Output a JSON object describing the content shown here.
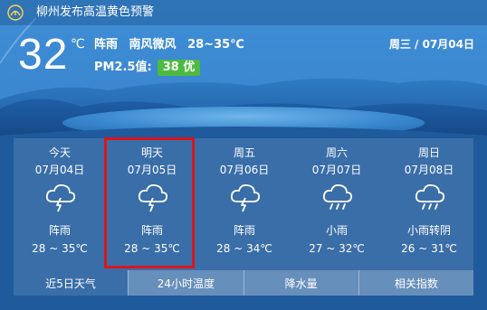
{
  "alert": {
    "icon": "storm-signal-icon",
    "text": "柳州发布高温黄色预警"
  },
  "current": {
    "temperature": "32",
    "unit": "℃",
    "condition": "阵雨",
    "wind": "南风微风",
    "range": "28~35℃",
    "pm_label": "PM2.5值:",
    "aqi": "38 优",
    "date": "周三 / 07月04日"
  },
  "forecast": [
    {
      "name": "今天",
      "date": "07月04日",
      "icon": "thunder-shower-icon",
      "condition": "阵雨",
      "temp": "28 ~ 35℃"
    },
    {
      "name": "明天",
      "date": "07月05日",
      "icon": "thunder-shower-icon",
      "condition": "阵雨",
      "temp": "28 ~ 35℃"
    },
    {
      "name": "周五",
      "date": "07月06日",
      "icon": "thunder-shower-icon",
      "condition": "阵雨",
      "temp": "28 ~ 34℃"
    },
    {
      "name": "周六",
      "date": "07月07日",
      "icon": "light-rain-icon",
      "condition": "小雨",
      "temp": "27 ~ 32℃"
    },
    {
      "name": "周日",
      "date": "07月08日",
      "icon": "light-rain-icon",
      "condition": "小雨转阴",
      "temp": "26 ~ 31℃"
    }
  ],
  "tabs": [
    "近5日天气",
    "24小时温度",
    "降水量",
    "相关指数"
  ],
  "colors": {
    "aqi_good": "#4dbb3f",
    "highlight": "#d9161c",
    "sky": "#2a6fb5"
  }
}
